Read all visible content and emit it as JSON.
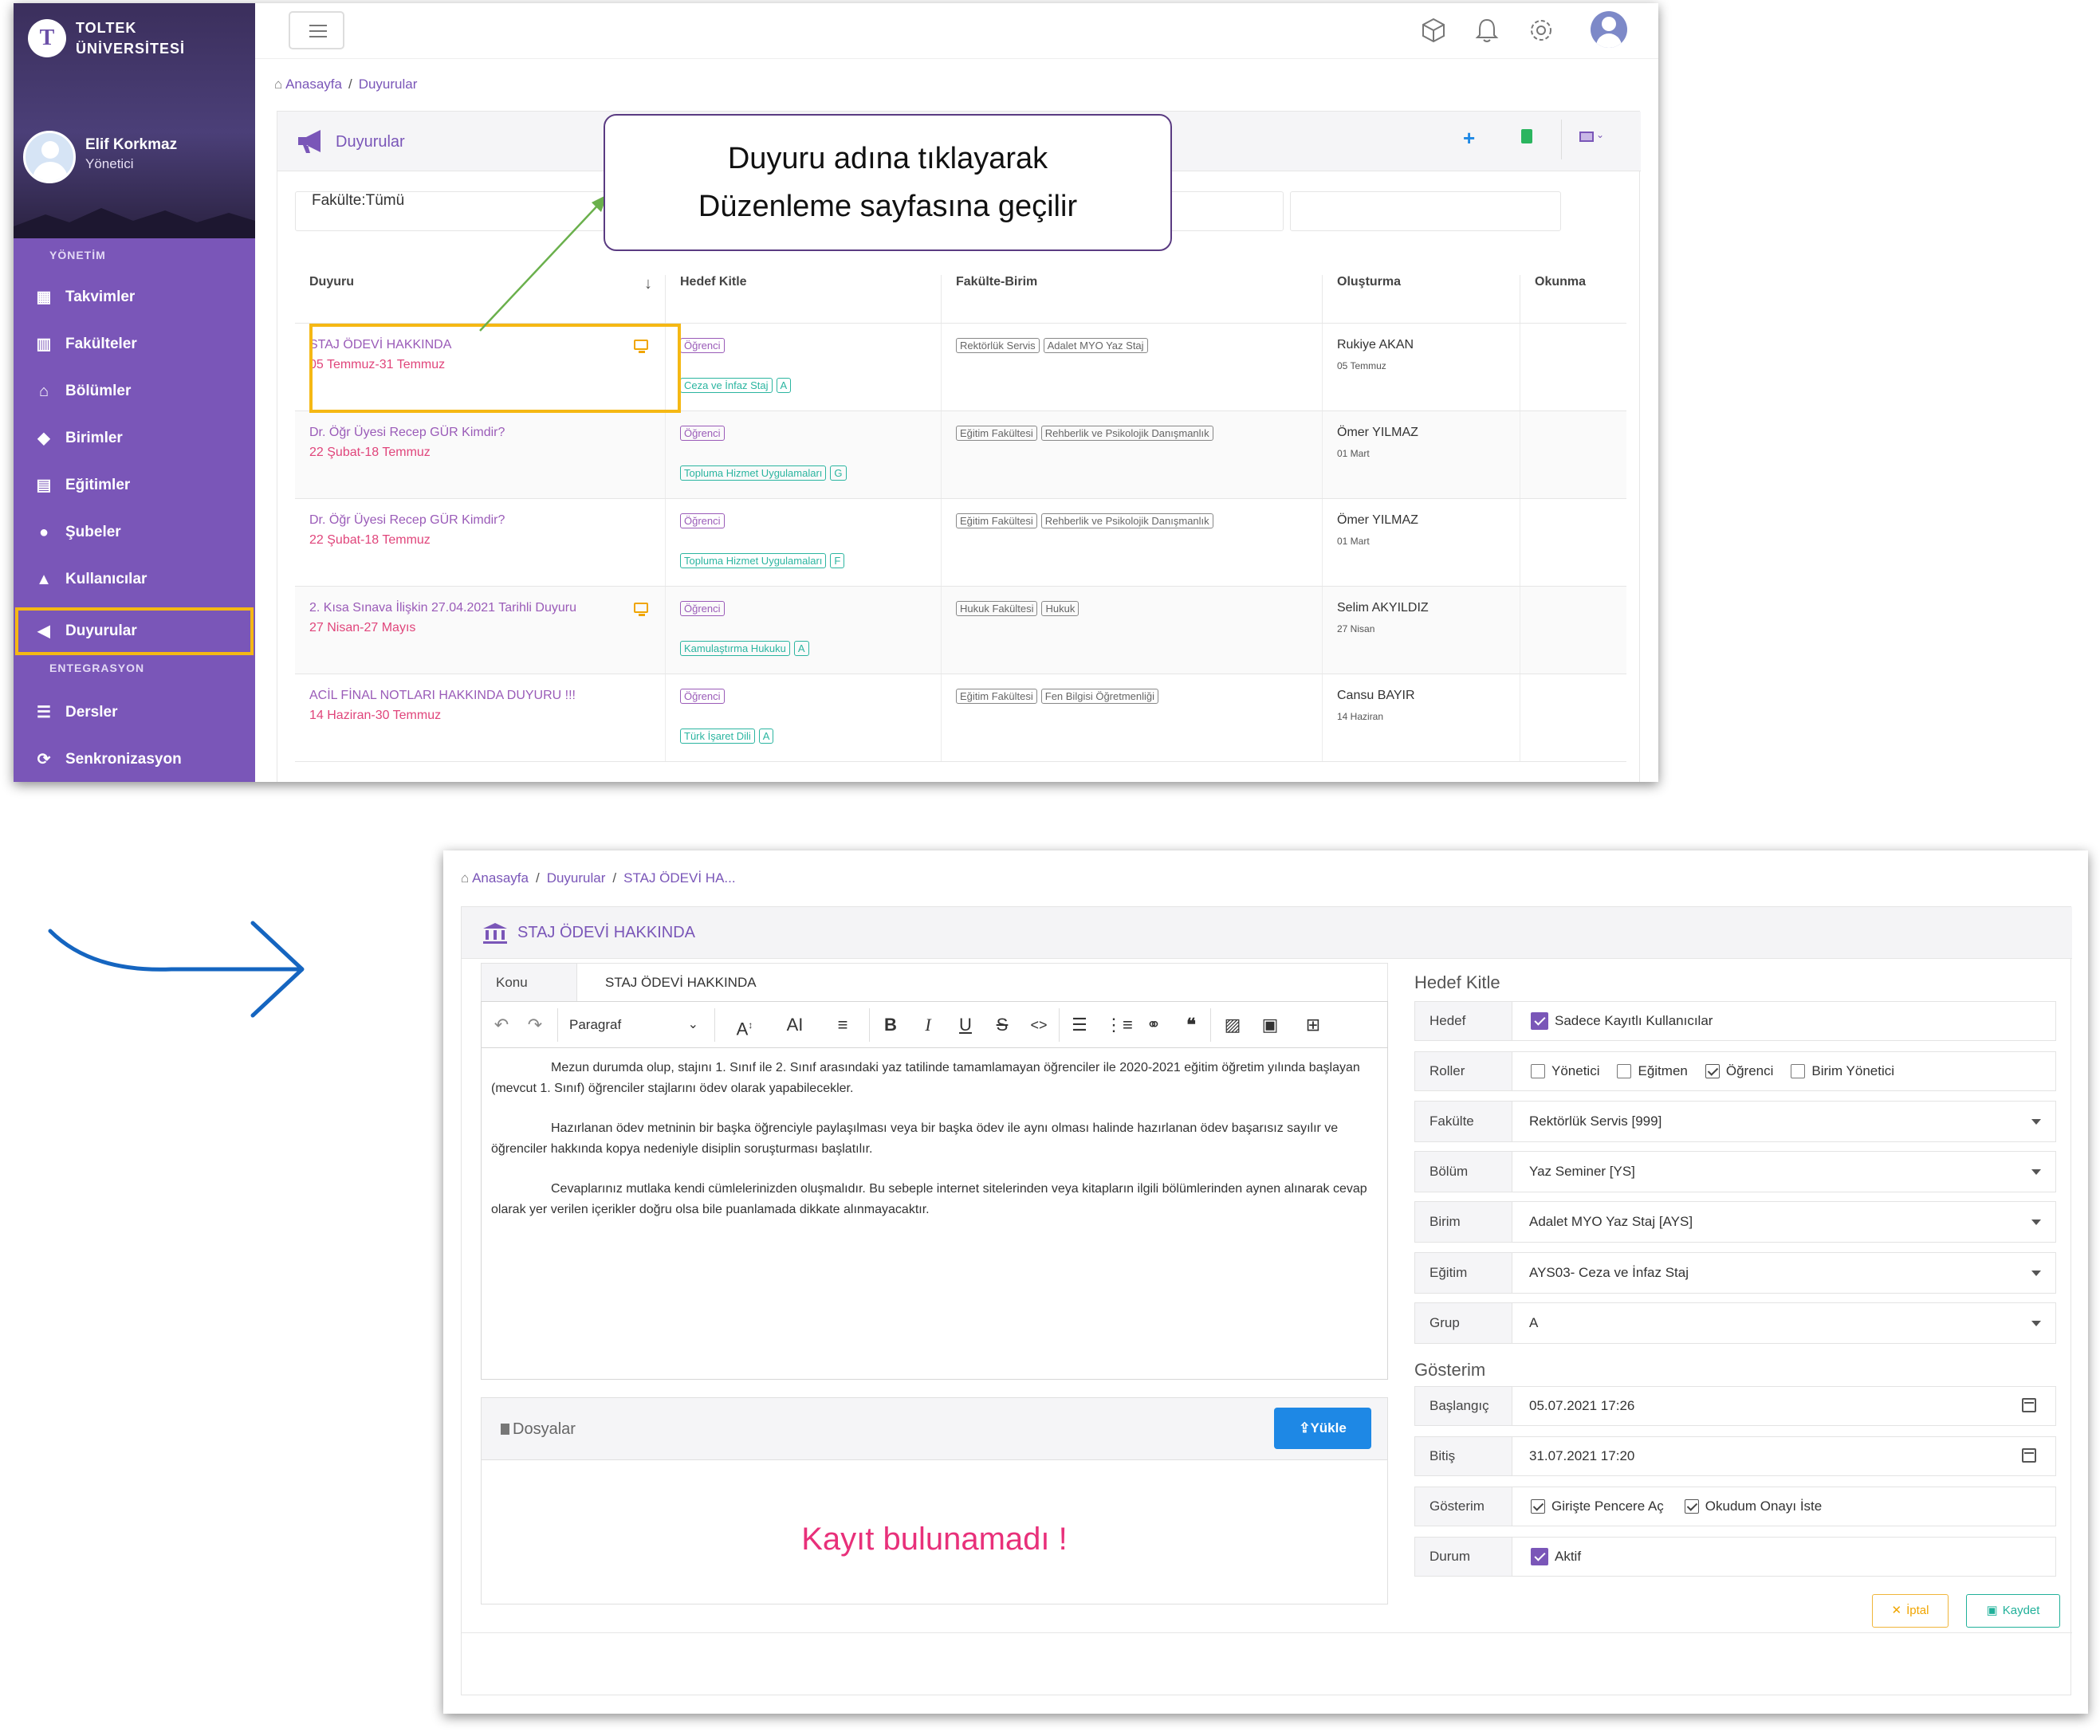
{
  "sidebar": {
    "brand_line1": "TOLTEK",
    "brand_line2": "ÜNİVERSİTESİ",
    "logo_letter": "T",
    "user_name": "Elif Korkmaz",
    "user_role": "Yönetici",
    "section_management": "YÖNETİM",
    "section_integration": "ENTEGRASYON",
    "items": [
      {
        "label": "Takvimler",
        "icon": "calendar-icon"
      },
      {
        "label": "Fakülteler",
        "icon": "building-icon"
      },
      {
        "label": "Bölümler",
        "icon": "institution-icon"
      },
      {
        "label": "Birimler",
        "icon": "graduation-cap-icon"
      },
      {
        "label": "Eğitimler",
        "icon": "book-icon"
      },
      {
        "label": "Şubeler",
        "icon": "users-icon"
      },
      {
        "label": "Kullanıcılar",
        "icon": "user-icon"
      },
      {
        "label": "Duyurular",
        "icon": "megaphone-icon",
        "active": true
      },
      {
        "label": "Dersler",
        "icon": "list-icon"
      },
      {
        "label": "Senkronizasyon",
        "icon": "sync-icon"
      }
    ],
    "active_highlight_color": "#f5b814"
  },
  "list_page": {
    "breadcrumb": [
      "Anasayfa",
      "Duyurular"
    ],
    "title": "Duyurular",
    "filter_text": "Fakülte:Tümü",
    "columns": [
      "Duyuru",
      "Hedef Kitle",
      "Fakülte-Birim",
      "Oluşturma",
      "Okunma"
    ],
    "sort_indicator": "↓",
    "rows": [
      {
        "title": "STAJ ÖDEVİ HAKKINDA",
        "dates": "05 Temmuz-31 Temmuz",
        "monitor": true,
        "audience": [
          "Öğrenci"
        ],
        "program": "Ceza ve İnfaz Staj",
        "group": "A",
        "units": [
          "Rektörlük Servis",
          "Adalet MYO Yaz Staj"
        ],
        "creator": "Rukiye AKAN",
        "created": "05 Temmuz"
      },
      {
        "title": "Dr. Öğr Üyesi Recep GÜR Kimdir?",
        "dates": "22 Şubat-18 Temmuz",
        "monitor": false,
        "audience": [
          "Öğrenci"
        ],
        "program": "Topluma Hizmet Uygulamaları",
        "group": "G",
        "units": [
          "Eğitim Fakültesi",
          "Rehberlik ve Psikolojik Danışmanlık"
        ],
        "creator": "Ömer YILMAZ",
        "created": "01 Mart"
      },
      {
        "title": "Dr. Öğr Üyesi Recep GÜR Kimdir?",
        "dates": "22 Şubat-18 Temmuz",
        "monitor": false,
        "audience": [
          "Öğrenci"
        ],
        "program": "Topluma Hizmet Uygulamaları",
        "group": "F",
        "units": [
          "Eğitim Fakültesi",
          "Rehberlik ve Psikolojik Danışmanlık"
        ],
        "creator": "Ömer YILMAZ",
        "created": "01 Mart"
      },
      {
        "title": "2. Kısa Sınava İlişkin 27.04.2021 Tarihli Duyuru",
        "dates": "27 Nisan-27 Mayıs",
        "monitor": true,
        "audience": [
          "Öğrenci"
        ],
        "program": "Kamulaştırma Hukuku",
        "group": "A",
        "units": [
          "Hukuk Fakültesi",
          "Hukuk"
        ],
        "creator": "Selim AKYILDIZ",
        "created": "27 Nisan"
      },
      {
        "title": "ACİL FİNAL NOTLARI HAKKINDA DUYURU !!!",
        "dates": "14 Haziran-30 Temmuz",
        "monitor": false,
        "audience": [
          "Öğrenci"
        ],
        "program": "Türk İşaret Dili",
        "group": "A",
        "units": [
          "Eğitim Fakültesi",
          "Fen Bilgisi Öğretmenliği"
        ],
        "creator": "Cansu BAYIR",
        "created": "14 Haziran"
      }
    ]
  },
  "callout": {
    "line1": "Duyuru adına tıklayarak",
    "line2": "Düzenleme sayfasına geçilir"
  },
  "edit_page": {
    "breadcrumb": [
      "Anasayfa",
      "Duyurular",
      "STAJ ÖDEVİ HA..."
    ],
    "title": "STAJ ÖDEVİ HAKKINDA",
    "subject_label": "Konu",
    "subject_value": "STAJ ÖDEVİ HAKKINDA",
    "paragraph_style": "Paragraf",
    "body": [
      "Mezun durumda olup, stajını 1. Sınıf ile 2. Sınıf arasındaki yaz tatilinde tamamlamayan öğrenciler ile 2020-2021 eğitim öğretim yılında başlayan (mevcut 1. Sınıf) öğrenciler stajlarını ödev olarak yapabilecekler.",
      "Hazırlanan ödev metninin bir başka öğrenciyle paylaşılması veya bir başka ödev ile  aynı olması halinde hazırlanan ödev başarısız sayılır ve öğrenciler hakkında kopya nedeniyle disiplin soruşturması başlatılır.",
      "Cevaplarınız mutlaka kendi cümlelerinizden oluşmalıdır. Bu sebeple internet sitelerinden veya kitapların ilgili bölümlerinden aynen alınarak cevap olarak yer verilen içerikler doğru olsa bile puanlamada dikkate alınmayacaktır."
    ],
    "files_title": "Dosyalar",
    "upload_label": "Yükle",
    "empty_message": "Kayıt bulunamadı !",
    "audience_title": "Hedef Kitle",
    "target_label": "Hedef",
    "target_value": "Sadece Kayıtlı Kullanıcılar",
    "roles_label": "Roller",
    "roles": [
      {
        "label": "Yönetici",
        "checked": false
      },
      {
        "label": "Eğitmen",
        "checked": false
      },
      {
        "label": "Öğrenci",
        "checked": true
      },
      {
        "label": "Birim Yönetici",
        "checked": false
      }
    ],
    "faculty_label": "Fakülte",
    "faculty_value": "Rektörlük Servis [999]",
    "department_label": "Bölüm",
    "department_value": "Yaz Seminer [YS]",
    "unit_label": "Birim",
    "unit_value": "Adalet MYO Yaz Staj [AYS]",
    "education_label": "Eğitim",
    "education_value": "AYS03- Ceza ve İnfaz Staj",
    "group_label": "Grup",
    "group_value": "A",
    "display_title": "Gösterim",
    "start_label": "Başlangıç",
    "start_value": "05.07.2021 17:26",
    "end_label": "Bitiş",
    "end_value": "31.07.2021 17:20",
    "display_label": "Gösterim",
    "display_options": [
      {
        "label": "Girişte Pencere Aç",
        "checked": true
      },
      {
        "label": "Okudum Onayı İste",
        "checked": true
      }
    ],
    "status_label": "Durum",
    "status_value": "Aktif",
    "cancel_label": "İptal",
    "save_label": "Kaydet"
  },
  "colors": {
    "brand_purple": "#7a56b8",
    "highlight_yellow": "#f5b814",
    "date_pink": "#e0457b",
    "tag_green": "#2bb5a0",
    "upload_blue": "#1e88e5",
    "empty_pink": "#e8307a",
    "arrow_blue": "#1565c0",
    "pointer_green": "#6ab04c"
  }
}
